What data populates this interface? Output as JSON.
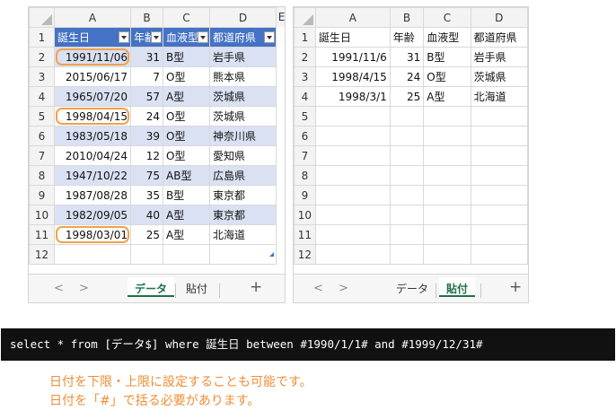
{
  "left_sheet": {
    "columns": [
      "A",
      "B",
      "C",
      "D",
      "E"
    ],
    "header": [
      "誕生日",
      "年齢",
      "血液型",
      "都道府県"
    ],
    "rows": [
      {
        "n": "2",
        "date": "1991/11/06",
        "age": "31",
        "blood": "B型",
        "pref": "岩手県"
      },
      {
        "n": "3",
        "date": "2015/06/17",
        "age": "7",
        "blood": "O型",
        "pref": "熊本県"
      },
      {
        "n": "4",
        "date": "1965/07/20",
        "age": "57",
        "blood": "A型",
        "pref": "茨城県"
      },
      {
        "n": "5",
        "date": "1998/04/15",
        "age": "24",
        "blood": "O型",
        "pref": "茨城県"
      },
      {
        "n": "6",
        "date": "1983/05/18",
        "age": "39",
        "blood": "O型",
        "pref": "神奈川県"
      },
      {
        "n": "7",
        "date": "2010/04/24",
        "age": "12",
        "blood": "O型",
        "pref": "愛知県"
      },
      {
        "n": "8",
        "date": "1947/10/22",
        "age": "75",
        "blood": "AB型",
        "pref": "広島県"
      },
      {
        "n": "9",
        "date": "1987/08/28",
        "age": "35",
        "blood": "B型",
        "pref": "東京都"
      },
      {
        "n": "10",
        "date": "1982/09/05",
        "age": "40",
        "blood": "A型",
        "pref": "東京都"
      },
      {
        "n": "11",
        "date": "1998/03/01",
        "age": "25",
        "blood": "A型",
        "pref": "北海道"
      }
    ],
    "tabs": [
      "データ",
      "貼付"
    ]
  },
  "right_sheet": {
    "columns": [
      "A",
      "B",
      "C",
      "D"
    ],
    "header": [
      "誕生日",
      "年齢",
      "血液型",
      "都道府県"
    ],
    "rows": [
      {
        "date": "1991/11/6",
        "age": "31",
        "blood": "B型",
        "pref": "岩手県"
      },
      {
        "date": "1998/4/15",
        "age": "24",
        "blood": "O型",
        "pref": "茨城県"
      },
      {
        "date": "1998/3/1",
        "age": "25",
        "blood": "A型",
        "pref": "北海道"
      }
    ],
    "tabs": [
      "データ",
      "貼付"
    ]
  },
  "row_numbers": [
    "1",
    "2",
    "3",
    "4",
    "5",
    "6",
    "7",
    "8",
    "9",
    "10",
    "11",
    "12"
  ],
  "nav": {
    "prev": "<",
    "next": ">",
    "add": "+"
  },
  "sql": "select * from [データ$] where 誕生日 between #1990/1/1# and #1999/12/31#",
  "notes": [
    "日付を下限・上限に設定することも可能です。",
    "日付を「#」で括る必要があります。"
  ],
  "colors": {
    "header_blue": "#4472c4",
    "band_blue": "#d9e1f2",
    "highlight_orange": "#f0a24c",
    "note_orange": "#ef8e36",
    "tab_green": "#1e7145"
  }
}
